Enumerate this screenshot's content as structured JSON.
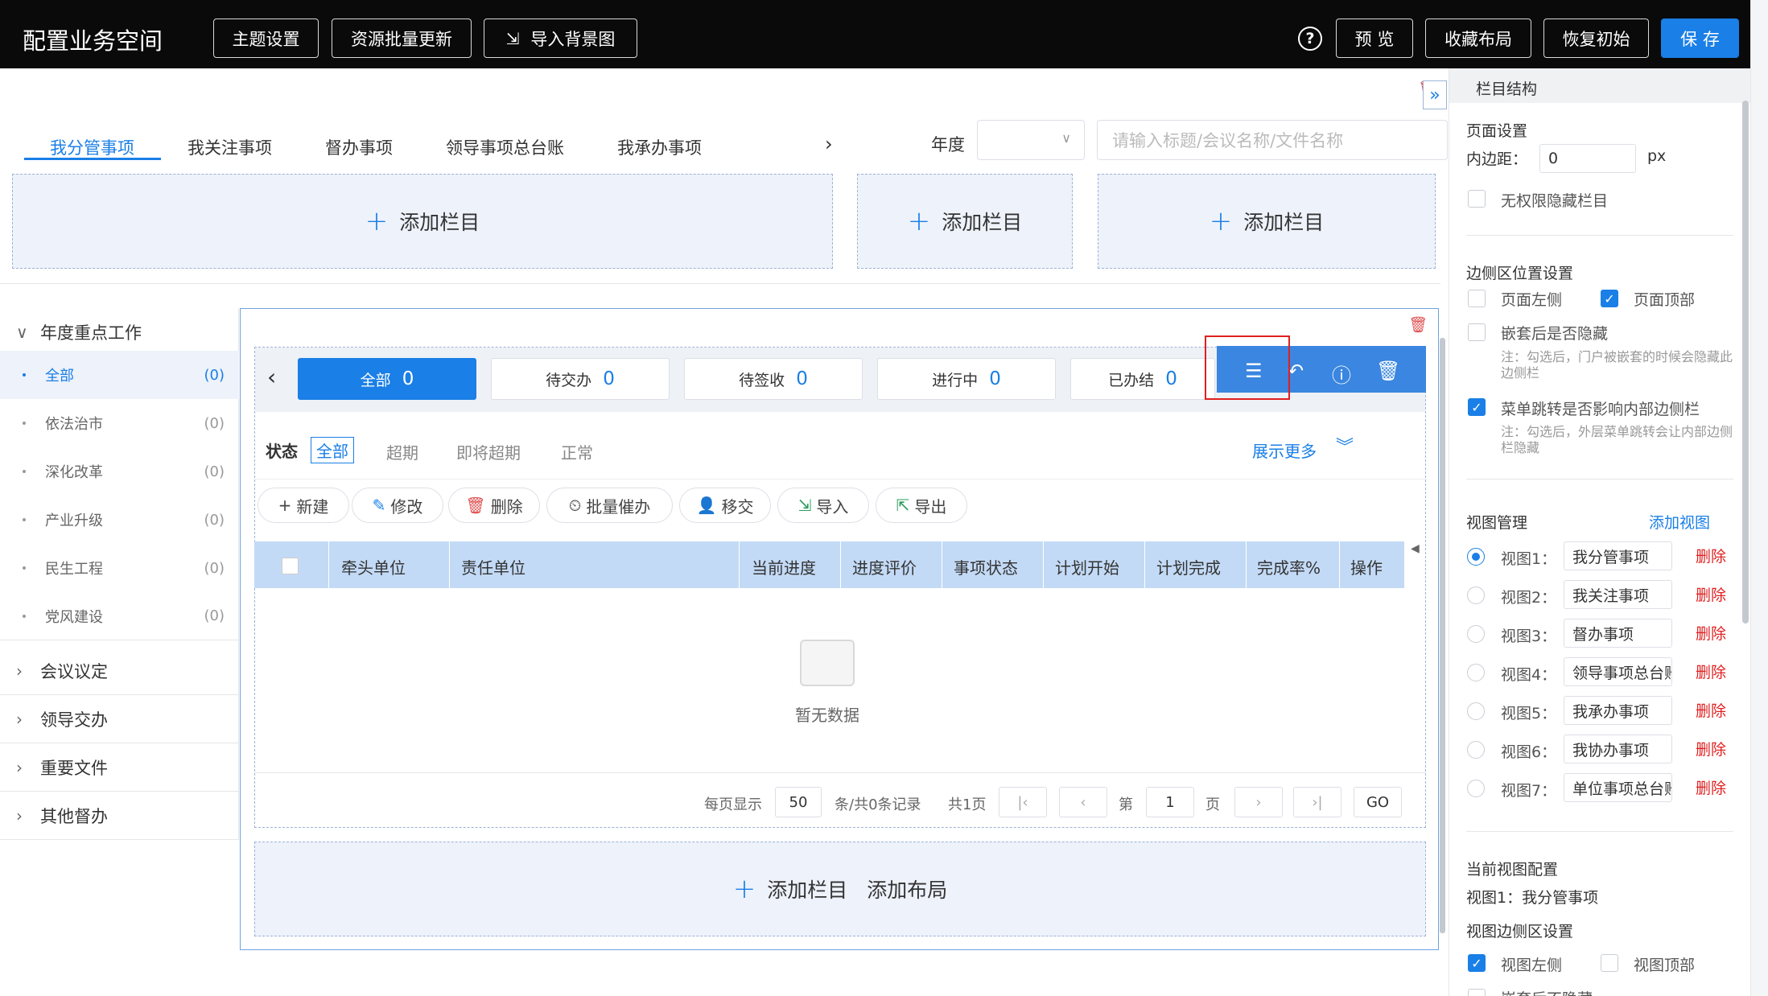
{
  "app": {
    "title": "配置业务空间"
  },
  "topbar": {
    "theme": "主题设置",
    "batch_update": "资源批量更新",
    "import_bg": "导入背景图",
    "preview": "预 览",
    "collect": "收藏布局",
    "reset": "恢复初始",
    "save": "保 存"
  },
  "tabs": [
    "我分管事项",
    "我关注事项",
    "督办事项",
    "领导事项总台账",
    "我承办事项"
  ],
  "filter": {
    "year_label": "年度",
    "search_placeholder": "请输入标题/会议名称/文件名称"
  },
  "add_column": "添加栏目",
  "add_layout": "添加布局",
  "sidebar": {
    "groups": [
      "年度重点工作",
      "会议议定",
      "领导交办",
      "重要文件",
      "其他督办"
    ],
    "items": [
      {
        "label": "全部",
        "count": "(0)"
      },
      {
        "label": "依法治市",
        "count": "(0)"
      },
      {
        "label": "深化改革",
        "count": "(0)"
      },
      {
        "label": "产业升级",
        "count": "(0)"
      },
      {
        "label": "民生工程",
        "count": "(0)"
      },
      {
        "label": "党风建设",
        "count": "(0)"
      }
    ]
  },
  "stats": [
    {
      "label": "全部",
      "num": "0"
    },
    {
      "label": "待交办",
      "num": "0"
    },
    {
      "label": "待签收",
      "num": "0"
    },
    {
      "label": "进行中",
      "num": "0"
    },
    {
      "label": "已办结",
      "num": "0"
    }
  ],
  "status": {
    "label": "状态",
    "options": [
      "全部",
      "超期",
      "即将超期",
      "正常"
    ],
    "more": "展示更多"
  },
  "actions": [
    "新建",
    "修改",
    "删除",
    "批量催办",
    "移交",
    "导入",
    "导出"
  ],
  "table": {
    "headers": [
      "牵头单位",
      "责任单位",
      "当前进度",
      "进度评价",
      "事项状态",
      "计划开始",
      "计划完成",
      "完成率%",
      "操作"
    ],
    "empty": "暂无数据"
  },
  "pagination": {
    "per_page_label": "每页显示",
    "per_page": "50",
    "records": "条/共0条记录",
    "pages": "共1页",
    "page_prefix": "第",
    "page": "1",
    "page_suffix": "页",
    "go": "GO"
  },
  "right_panel": {
    "header": "栏目结构",
    "page_settings": "页面设置",
    "padding_label": "内边距：",
    "padding_value": "0",
    "padding_unit": "px",
    "hide_no_perm": "无权限隐藏栏目",
    "side_pos": "边侧区位置设置",
    "page_left": "页面左侧",
    "page_top": "页面顶部",
    "nested_hide": "嵌套后是否隐藏",
    "nested_note": "注：勾选后，门户被嵌套的时候会隐藏此边侧栏",
    "menu_jump": "菜单跳转是否影响内部边侧栏",
    "menu_note": "注：勾选后，外层菜单跳转会让内部边侧栏隐藏",
    "view_mgmt": "视图管理",
    "add_view": "添加视图",
    "views": [
      {
        "label": "视图1：",
        "value": "我分管事项"
      },
      {
        "label": "视图2：",
        "value": "我关注事项"
      },
      {
        "label": "视图3：",
        "value": "督办事项"
      },
      {
        "label": "视图4：",
        "value": "领导事项总台账"
      },
      {
        "label": "视图5：",
        "value": "我承办事项"
      },
      {
        "label": "视图6：",
        "value": "我协办事项"
      },
      {
        "label": "视图7：",
        "value": "单位事项总台账"
      }
    ],
    "delete": "删除",
    "current_view_cfg": "当前视图配置",
    "current_view": "视图1：我分管事项",
    "view_side": "视图边侧区设置",
    "view_left": "视图左侧",
    "view_top": "视图顶部",
    "view_nested": "嵌套后不隐藏"
  },
  "colors": {
    "accent": "#1a7fe6",
    "topbar": "#0a0a0a",
    "danger": "#e02020",
    "table_header": "#c3daf6"
  }
}
